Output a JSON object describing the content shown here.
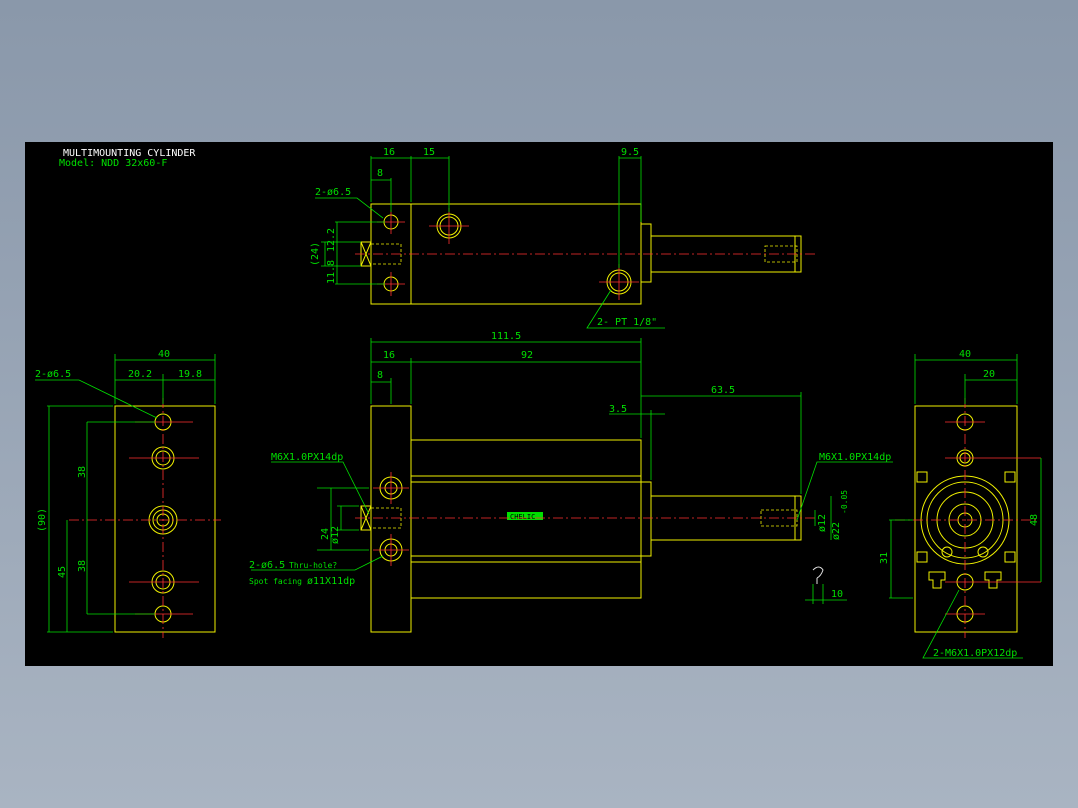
{
  "title": {
    "line1": "MULTIMOUNTING CYLINDER",
    "line2": "Model: NDD 32x60-F"
  },
  "top_view": {
    "dim_16": "16",
    "dim_15": "15",
    "dim_8": "8",
    "dim_9_5": "9.5",
    "dim_24": "(24)",
    "dim_12_2": "12.2",
    "dim_11_8": "11.8",
    "hole_label": "2-ø6.5",
    "port_label": "2- PT 1/8\""
  },
  "left_view": {
    "dim_40": "40",
    "dim_20_2": "20.2",
    "dim_19_8": "19.8",
    "hole_label": "2-ø6.5",
    "dim_90": "(90)",
    "dim_38a": "38",
    "dim_45": "45",
    "dim_38b": "38"
  },
  "front_view": {
    "dim_111_5": "111.5",
    "dim_16": "16",
    "dim_92": "92",
    "dim_8": "8",
    "dim_63_5": "63.5",
    "dim_3_5": "3.5",
    "thread_left": "M6X1.0PX14dp",
    "thread_right": "M6X1.0PX14dp",
    "dim_12_left": "ø12",
    "dim_24": "24",
    "dim_12_right": "ø12",
    "dim_22": "ø22",
    "tol": "-0.05",
    "hole_label": "2-ø6.5",
    "thru": "Thru-hole?",
    "spot_facing": "Spot facing",
    "spot_dim": "ø11X11dp",
    "dim_10": "10",
    "brand": "CHELIC"
  },
  "right_view": {
    "dim_40": "40",
    "dim_20": "20",
    "dim_48": "48",
    "dim_31": "31",
    "thread_label": "2-M6X1.0PX12dp"
  }
}
